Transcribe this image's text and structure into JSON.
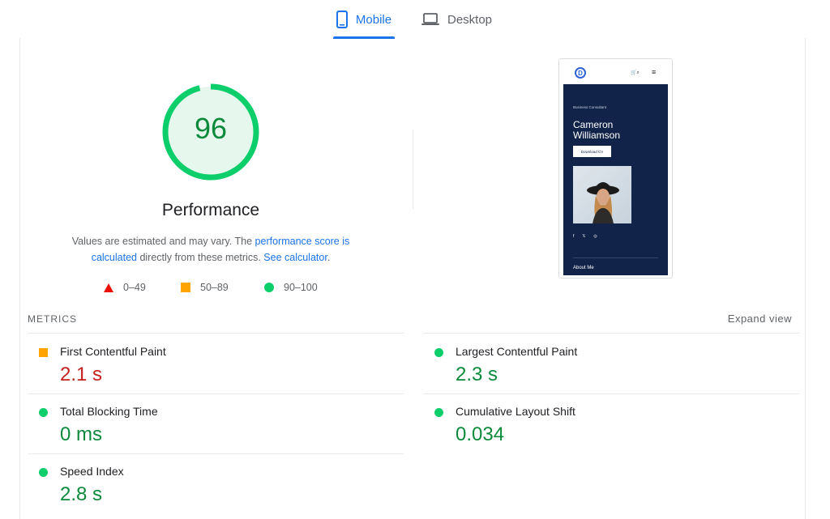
{
  "tabs": {
    "mobile": "Mobile",
    "desktop": "Desktop",
    "active": "Mobile"
  },
  "score": {
    "value": "96",
    "fraction": 0.96,
    "label": "Performance",
    "ring_color": "#0cce6b",
    "text_color": "#0c8a3c"
  },
  "description": {
    "part1": "Values are estimated and may vary. The ",
    "link1": "performance score is calculated",
    "part2": " directly from these metrics. ",
    "link2": "See calculator",
    "part3": "."
  },
  "legend": [
    {
      "range": "0–49",
      "icon": "triangle-icon",
      "color": "#eb0f00"
    },
    {
      "range": "50–89",
      "icon": "square-icon",
      "color": "#ffa400"
    },
    {
      "range": "90–100",
      "icon": "circle-icon",
      "color": "#0cce6b"
    }
  ],
  "preview": {
    "logo": "D",
    "tagline": "Business Consultant",
    "name": "Cameron Williamson",
    "button": "Download CV",
    "about": "About Me",
    "social": [
      "f",
      "𝕏",
      "◎"
    ]
  },
  "metrics": {
    "title": "METRICS",
    "expand": "Expand view",
    "items": [
      {
        "name": "First Contentful Paint",
        "value": "2.1 s",
        "status": "orange"
      },
      {
        "name": "Largest Contentful Paint",
        "value": "2.3 s",
        "status": "green"
      },
      {
        "name": "Total Blocking Time",
        "value": "0 ms",
        "status": "green"
      },
      {
        "name": "Cumulative Layout Shift",
        "value": "0.034",
        "status": "green"
      },
      {
        "name": "Speed Index",
        "value": "2.8 s",
        "status": "green"
      }
    ]
  }
}
